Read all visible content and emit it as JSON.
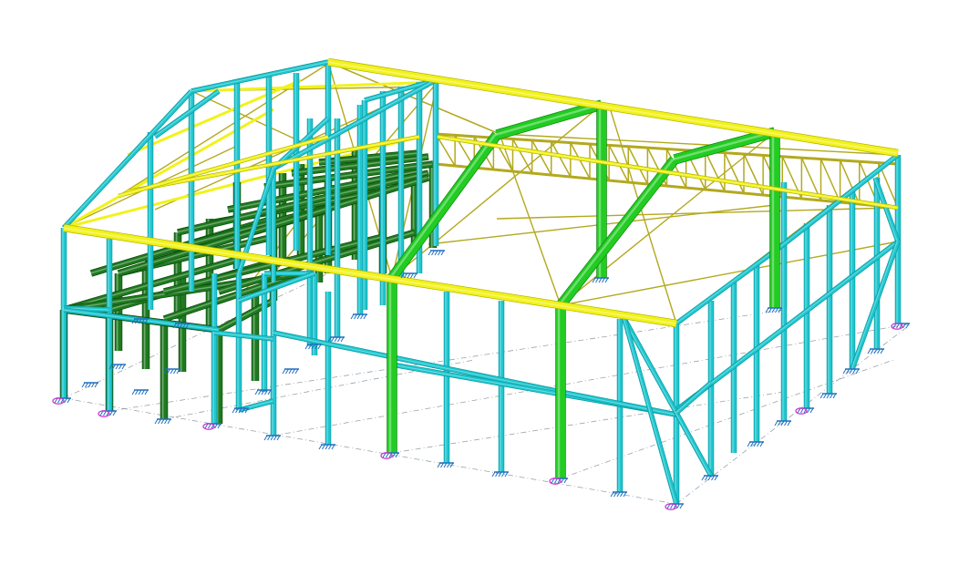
{
  "view": {
    "projection": "isometric",
    "background": "#ffffff"
  },
  "colors": {
    "column_cyan": "#1fc7cf",
    "column_cyan_dark": "#0e9aa2",
    "rafter_green": "#22cc22",
    "rafter_green_dark": "#0e8a0e",
    "mezzanine_green": "#1f7a1f",
    "mezzanine_green_dark": "#0d4d0d",
    "eave_yellow": "#f2f21a",
    "eave_yellow_dark": "#b8b800",
    "bracing_olive": "#b3a91e",
    "support_blue": "#1f6fbf",
    "support_pin_magenta": "#d23cd2",
    "grid_line": "#9aa3aa"
  },
  "members": {
    "columns": "cyan",
    "portal_frames": "light-green",
    "mezzanine_frame": "dark-green",
    "eave_beams": "yellow",
    "roof_bracing_and_truss": "olive"
  },
  "icons": {
    "fixed_support": "fixed-support-icon",
    "pinned_support": "pinned-support-icon"
  }
}
